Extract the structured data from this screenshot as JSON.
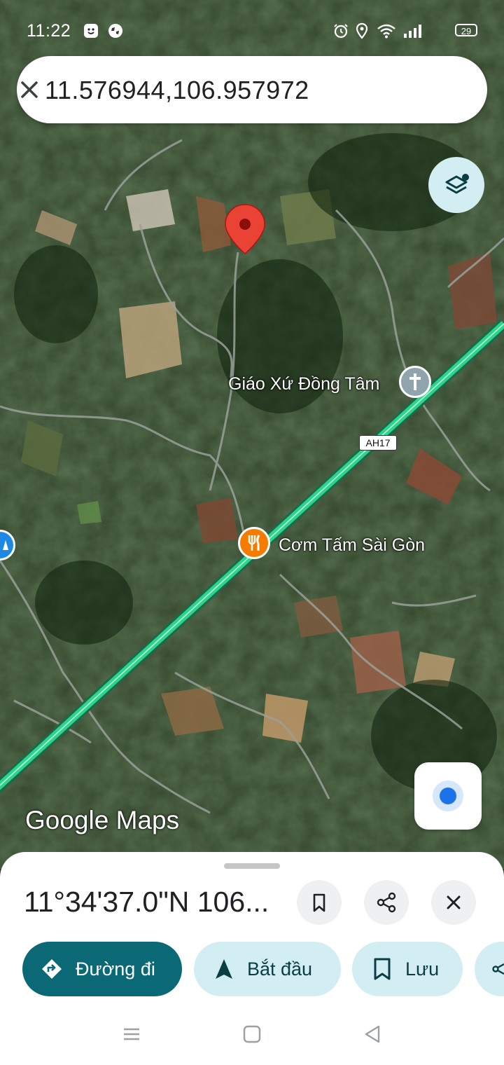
{
  "status_bar": {
    "time": "11:22",
    "icons": [
      "face-icon",
      "globe-icon",
      "alarm-icon",
      "location-icon",
      "wifi-icon",
      "signal-icon"
    ],
    "battery": "29"
  },
  "search": {
    "query": "11.576944,106.957972"
  },
  "map": {
    "type": "satellite",
    "pin_color": "#ea4335",
    "route_color": "#2bd58e",
    "labels": {
      "church": "Giáo Xứ Đồng Tâm",
      "restaurant": "Cơm Tấm Sài Gòn",
      "road_badge": "AH17"
    },
    "brand": "Google Maps"
  },
  "place_sheet": {
    "coordinates": "11°34'37.0\"N 106...",
    "actions": {
      "directions": "Đường đi",
      "start": "Bắt đầu",
      "save": "Lưu"
    }
  },
  "colors": {
    "primary": "#0b6875",
    "secondary_bg": "#d3eef3"
  }
}
